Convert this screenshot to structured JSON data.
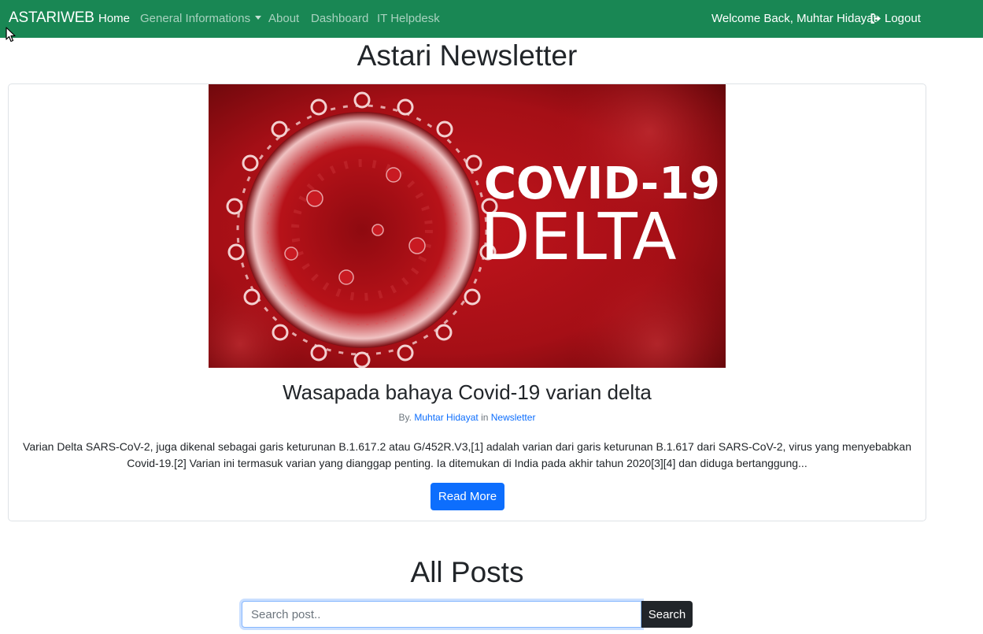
{
  "nav": {
    "brand": "ASTARIWEB",
    "items": [
      {
        "label": "Home"
      },
      {
        "label": "General Informations"
      },
      {
        "label": "About"
      },
      {
        "label": "Dashboard"
      },
      {
        "label": "IT Helpdesk"
      }
    ],
    "welcome": "Welcome Back, Muhtar Hidayat",
    "logout": "Logout"
  },
  "page_title": "Astari Newsletter",
  "featured": {
    "image_text_line1": "COVID-19",
    "image_text_line2": "DELTA",
    "title": "Wasapada bahaya Covid-19 varian delta",
    "by_prefix": "By.",
    "author": "Muhtar Hidayat",
    "in_word": "in",
    "category": "Newsletter",
    "excerpt": "Varian Delta SARS-CoV-2, juga dikenal sebagai garis keturunan B.1.617.2 atau G/452R.V3,[1] adalah varian dari garis keturunan B.1.617 dari SARS-CoV-2, virus yang menyebabkan Covid-19.[2] Varian ini termasuk varian yang dianggap penting. Ia ditemukan di India pada akhir tahun 2020[3][4] dan diduga bertanggung...",
    "read_more": "Read More"
  },
  "all_posts_title": "All Posts",
  "search": {
    "placeholder": "Search post..",
    "value": "",
    "button": "Search"
  },
  "colors": {
    "navbar": "#198754",
    "primary": "#0d6efd",
    "dark": "#212529",
    "image_red": "#b3121a"
  }
}
